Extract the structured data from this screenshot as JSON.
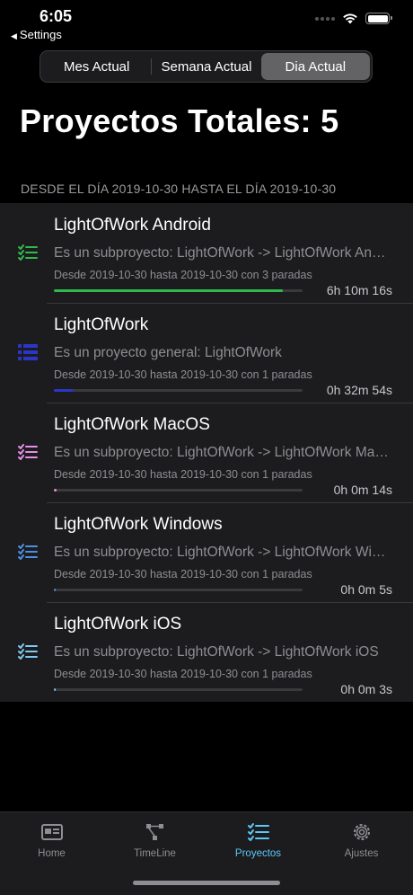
{
  "status": {
    "time": "6:05",
    "back_label": "Settings"
  },
  "segments": [
    {
      "label": "Mes Actual",
      "selected": false
    },
    {
      "label": "Semana Actual",
      "selected": false
    },
    {
      "label": "Dia Actual",
      "selected": true
    }
  ],
  "header": {
    "title": "Proyectos Totales: 5",
    "date_range": "DESDE EL DÍA 2019-10-30 HASTA EL DÍA 2019-10-30"
  },
  "projects": [
    {
      "title": "LightOfWork Android",
      "subtitle": "Es un subproyecto: LightOfWork -> LightOfWork Android",
      "detail": "Desde 2019-10-30 hasta 2019-10-30 con 3 paradas",
      "duration": "6h 10m 16s",
      "progress": 0.92,
      "color": "#30b94d",
      "icon": "checklist-icon"
    },
    {
      "title": "LightOfWork",
      "subtitle": "Es un proyecto general: LightOfWork",
      "detail": "Desde 2019-10-30 hasta 2019-10-30 con 1 paradas",
      "duration": "0h 32m 54s",
      "progress": 0.08,
      "color": "#2b36c8",
      "icon": "list-icon"
    },
    {
      "title": "LightOfWork MacOS",
      "subtitle": "Es un subproyecto: LightOfWork -> LightOfWork MacOS",
      "detail": "Desde 2019-10-30 hasta 2019-10-30 con 1 paradas",
      "duration": "0h 0m 14s",
      "progress": 0.012,
      "color": "#e58fe6",
      "icon": "checklist-icon"
    },
    {
      "title": "LightOfWork Windows",
      "subtitle": "Es un subproyecto: LightOfWork -> LightOfWork Windows",
      "detail": "Desde 2019-10-30 hasta 2019-10-30 con 1 paradas",
      "duration": "0h 0m 5s",
      "progress": 0.008,
      "color": "#4a90e2",
      "icon": "checklist-icon"
    },
    {
      "title": "LightOfWork iOS",
      "subtitle": "Es un subproyecto: LightOfWork -> LightOfWork iOS",
      "detail": "Desde 2019-10-30 hasta 2019-10-30 con 1 paradas",
      "duration": "0h 0m 3s",
      "progress": 0.006,
      "color": "#7fc8ef",
      "icon": "checklist-icon"
    }
  ],
  "tabs": [
    {
      "label": "Home",
      "icon": "home-card-icon",
      "active": false
    },
    {
      "label": "TimeLine",
      "icon": "timeline-icon",
      "active": false
    },
    {
      "label": "Proyectos",
      "icon": "checklist-icon",
      "active": true
    },
    {
      "label": "Ajustes",
      "icon": "gear-icon",
      "active": false
    }
  ],
  "colors": {
    "accent": "#5ac8fa",
    "inactive": "#8e8e93"
  }
}
